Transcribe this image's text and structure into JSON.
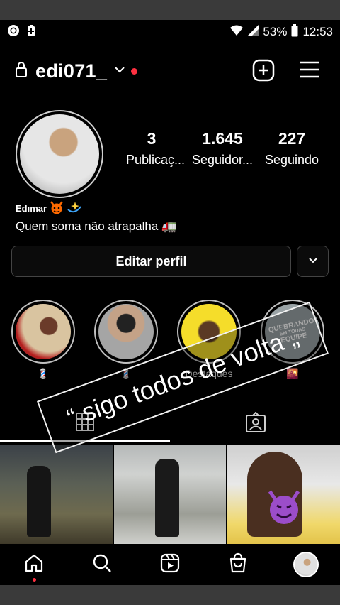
{
  "status_bar": {
    "battery": "53%",
    "time": "12:53"
  },
  "header": {
    "username": "edi071_"
  },
  "stats": [
    {
      "number": "3",
      "label": "Publicaç..."
    },
    {
      "number": "1.645",
      "label": "Seguidor..."
    },
    {
      "number": "227",
      "label": "Seguindo"
    }
  ],
  "profile": {
    "display_name": "Edımar",
    "bio": "Quem soma não atrapalha 🚛"
  },
  "buttons": {
    "edit_profile": "Editar perfil"
  },
  "highlights": [
    {
      "label": "💈"
    },
    {
      "label": "💈"
    },
    {
      "label": "Destaques"
    },
    {
      "label": "🌇"
    }
  ],
  "highlight4_text": [
    "QUEBRANDO",
    "EM TODAS",
    "EQUIPE"
  ],
  "overlay": {
    "text": "“ sigo todos de volta „"
  },
  "colors": {
    "notification": "#ff3040",
    "background": "#000000"
  }
}
